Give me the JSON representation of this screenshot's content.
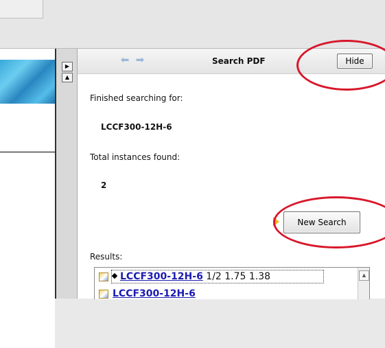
{
  "header": {
    "title": "Search PDF",
    "hide_label": "Hide"
  },
  "search": {
    "finished_label": "Finished searching for:",
    "query": "LCCF300-12H-6",
    "total_label": "Total instances found:",
    "count": "2",
    "new_search_label": "New Search"
  },
  "results": {
    "label": "Results:",
    "items": [
      {
        "term": "LCCF300-12H-6",
        "detail": "1/2 1.75 1.38"
      },
      {
        "term": "LCCF300-12H-6",
        "detail": ""
      }
    ]
  },
  "highlight_color": "#d8172a"
}
